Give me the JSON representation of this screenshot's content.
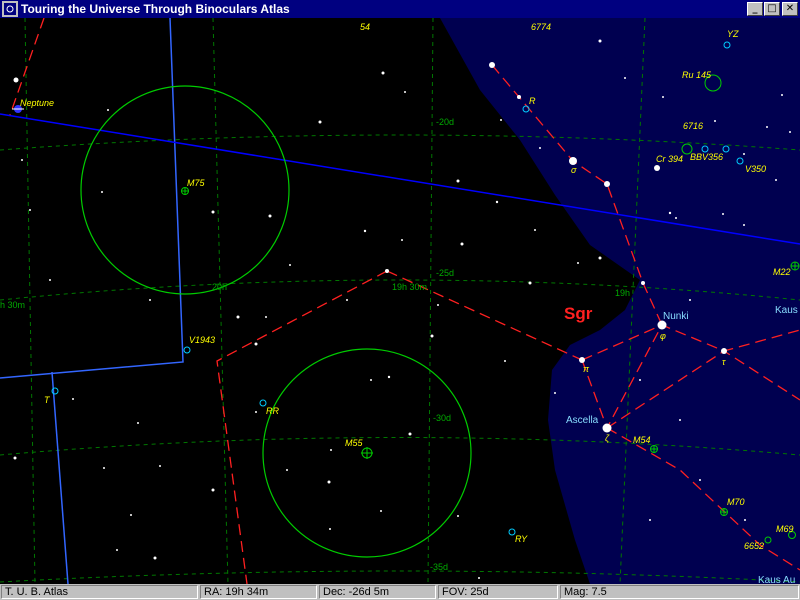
{
  "window": {
    "title": "Touring the Universe Through Binoculars Atlas",
    "minimize_glyph": "_",
    "maximize_glyph": "□",
    "close_glyph": "✕"
  },
  "map": {
    "constellation": "Sgr",
    "grid_labels": {
      "dec_20": "-20d",
      "dec_25": "-25d",
      "dec_30": "-30d",
      "dec_35": "-35d",
      "ra_19h30": "19h 30m",
      "ra_19h": "19h",
      "ra_20h": "20h",
      "ra_left": "h 30m"
    },
    "objects": {
      "neptune": "Neptune",
      "m75": "M75",
      "m55": "M55",
      "v1943": "V1943",
      "rr": "RR",
      "ry": "RY",
      "t": "T",
      "r": "R",
      "ru145": "Ru 145",
      "ngc6716": "6716",
      "cr394": "Cr 394",
      "bbv356": "BBV356",
      "v350": "V350",
      "yz": "YZ",
      "ngc6774": "6774",
      "n54": "54",
      "m22": "M22",
      "m54": "M54",
      "m70": "M70",
      "m69": "M69",
      "ngc6652": "6652"
    },
    "stars": {
      "nunki": "Nunki",
      "ascella": "Ascella",
      "kaus1": "Kaus",
      "kaus2": "Kaus Au",
      "greek_sigma": "σ",
      "greek_zeta": "ζ",
      "greek_phi": "φ",
      "greek_tau": "τ",
      "greek_pi": "π"
    },
    "colors": {
      "milky_way": "#000050",
      "constellation_line": "#ff2020",
      "ecliptic": "#0000ff",
      "boundary": "#3366ff",
      "grid": "#007700",
      "binocular_field": "#00cc00",
      "label": "#ffff00",
      "object_marker": "#00ccff"
    }
  },
  "statusbar": {
    "app": "T. U. B. Atlas",
    "ra": "RA: 19h 34m",
    "dec": "Dec: -26d 5m",
    "fov": "FOV: 25d",
    "mag": "Mag: 7.5"
  }
}
